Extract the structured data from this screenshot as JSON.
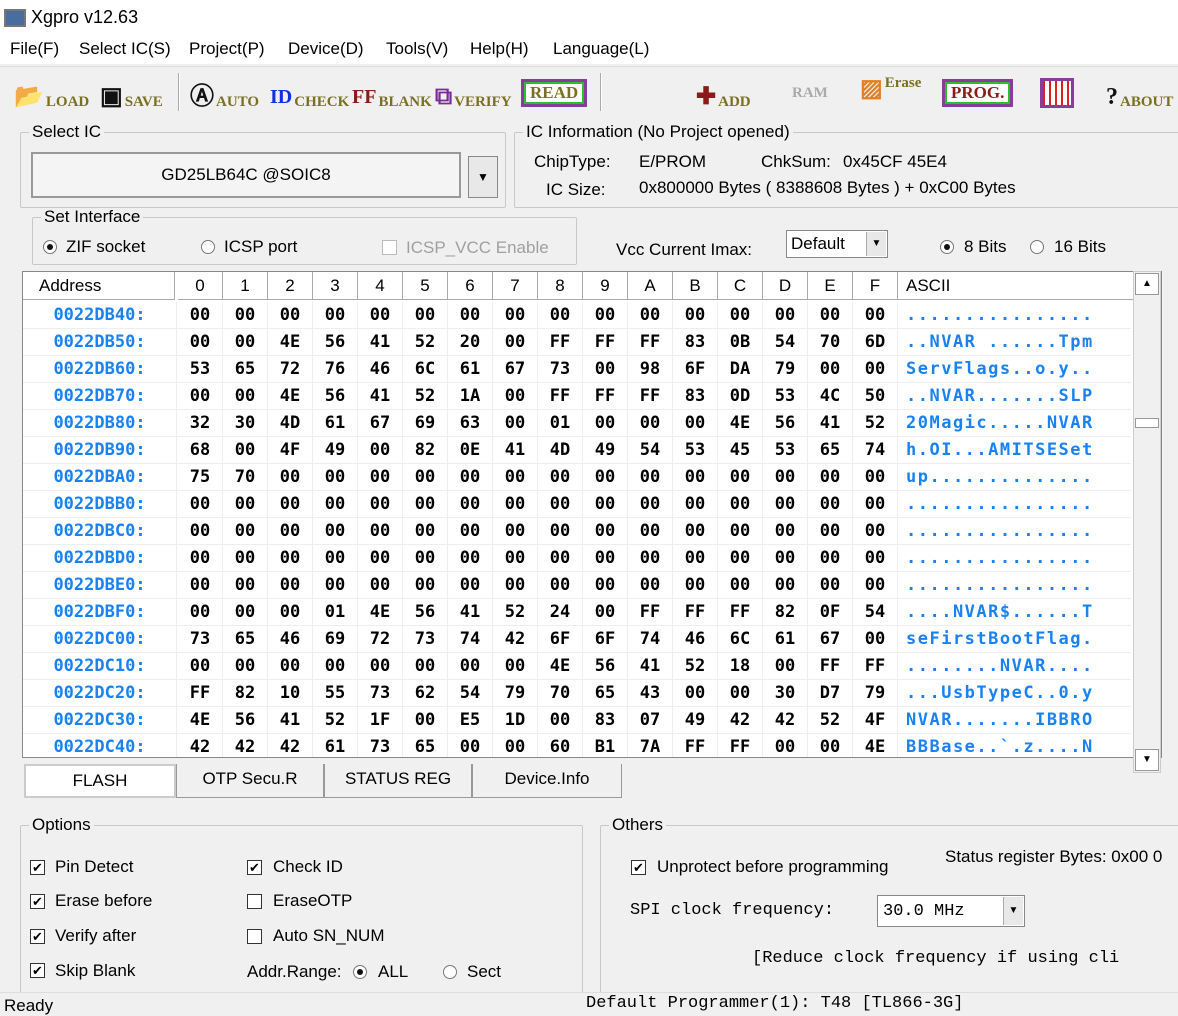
{
  "window": {
    "title": "Xgpro v12.63"
  },
  "menu": [
    "File(F)",
    "Select IC(S)",
    "Project(P)",
    "Device(D)",
    "Tools(V)",
    "Help(H)",
    "Language(L)"
  ],
  "toolbar": {
    "load": "LOAD",
    "save": "SAVE",
    "auto": "AUTO",
    "check": "CHECK",
    "blank": "BLANK",
    "verify": "VERIFY",
    "read": "READ",
    "add": "ADD",
    "ram": "RAM",
    "erase": "Erase",
    "prog": "PROG.",
    "about": "ABOUT",
    "check_icon_text": "ID",
    "blank_icon_text": "FF"
  },
  "select_ic": {
    "legend": "Select IC",
    "value": "GD25LB64C @SOIC8"
  },
  "ic_info": {
    "legend": "IC Information (No Project opened)",
    "chip_type_label": "ChipType:",
    "chip_type": "E/PROM",
    "chksum_label": "ChkSum:",
    "chksum": "0x45CF 45E4",
    "ic_size_label": "IC Size:",
    "ic_size": "0x800000 Bytes ( 8388608 Bytes ) + 0xC00 Bytes"
  },
  "interface": {
    "legend": "Set Interface",
    "zif": "ZIF socket",
    "icsp": "ICSP port",
    "icsp_vcc": "ICSP_VCC Enable",
    "selected": "ZIF socket"
  },
  "vcc": {
    "label": "Vcc Current Imax:",
    "value": "Default"
  },
  "bits": {
    "b8": "8 Bits",
    "b16": "16 Bits",
    "selected": "8 Bits"
  },
  "hex": {
    "headers": [
      "Address",
      "0",
      "1",
      "2",
      "3",
      "4",
      "5",
      "6",
      "7",
      "8",
      "9",
      "A",
      "B",
      "C",
      "D",
      "E",
      "F",
      "ASCII"
    ],
    "rows": [
      {
        "addr": "0022DB40:",
        "bytes": [
          "00",
          "00",
          "00",
          "00",
          "00",
          "00",
          "00",
          "00",
          "00",
          "00",
          "00",
          "00",
          "00",
          "00",
          "00",
          "00"
        ],
        "ascii": "................"
      },
      {
        "addr": "0022DB50:",
        "bytes": [
          "00",
          "00",
          "4E",
          "56",
          "41",
          "52",
          "20",
          "00",
          "FF",
          "FF",
          "FF",
          "83",
          "0B",
          "54",
          "70",
          "6D"
        ],
        "ascii": "..NVAR ......Tpm"
      },
      {
        "addr": "0022DB60:",
        "bytes": [
          "53",
          "65",
          "72",
          "76",
          "46",
          "6C",
          "61",
          "67",
          "73",
          "00",
          "98",
          "6F",
          "DA",
          "79",
          "00",
          "00"
        ],
        "ascii": "ServFlags..o.y.."
      },
      {
        "addr": "0022DB70:",
        "bytes": [
          "00",
          "00",
          "4E",
          "56",
          "41",
          "52",
          "1A",
          "00",
          "FF",
          "FF",
          "FF",
          "83",
          "0D",
          "53",
          "4C",
          "50"
        ],
        "ascii": "..NVAR.......SLP"
      },
      {
        "addr": "0022DB80:",
        "bytes": [
          "32",
          "30",
          "4D",
          "61",
          "67",
          "69",
          "63",
          "00",
          "01",
          "00",
          "00",
          "00",
          "4E",
          "56",
          "41",
          "52"
        ],
        "ascii": "20Magic.....NVAR"
      },
      {
        "addr": "0022DB90:",
        "bytes": [
          "68",
          "00",
          "4F",
          "49",
          "00",
          "82",
          "0E",
          "41",
          "4D",
          "49",
          "54",
          "53",
          "45",
          "53",
          "65",
          "74"
        ],
        "ascii": "h.OI...AMITSESet"
      },
      {
        "addr": "0022DBA0:",
        "bytes": [
          "75",
          "70",
          "00",
          "00",
          "00",
          "00",
          "00",
          "00",
          "00",
          "00",
          "00",
          "00",
          "00",
          "00",
          "00",
          "00"
        ],
        "ascii": "up.............."
      },
      {
        "addr": "0022DBB0:",
        "bytes": [
          "00",
          "00",
          "00",
          "00",
          "00",
          "00",
          "00",
          "00",
          "00",
          "00",
          "00",
          "00",
          "00",
          "00",
          "00",
          "00"
        ],
        "ascii": "................"
      },
      {
        "addr": "0022DBC0:",
        "bytes": [
          "00",
          "00",
          "00",
          "00",
          "00",
          "00",
          "00",
          "00",
          "00",
          "00",
          "00",
          "00",
          "00",
          "00",
          "00",
          "00"
        ],
        "ascii": "................"
      },
      {
        "addr": "0022DBD0:",
        "bytes": [
          "00",
          "00",
          "00",
          "00",
          "00",
          "00",
          "00",
          "00",
          "00",
          "00",
          "00",
          "00",
          "00",
          "00",
          "00",
          "00"
        ],
        "ascii": "................"
      },
      {
        "addr": "0022DBE0:",
        "bytes": [
          "00",
          "00",
          "00",
          "00",
          "00",
          "00",
          "00",
          "00",
          "00",
          "00",
          "00",
          "00",
          "00",
          "00",
          "00",
          "00"
        ],
        "ascii": "................"
      },
      {
        "addr": "0022DBF0:",
        "bytes": [
          "00",
          "00",
          "00",
          "01",
          "4E",
          "56",
          "41",
          "52",
          "24",
          "00",
          "FF",
          "FF",
          "FF",
          "82",
          "0F",
          "54"
        ],
        "ascii": "....NVAR$......T"
      },
      {
        "addr": "0022DC00:",
        "bytes": [
          "73",
          "65",
          "46",
          "69",
          "72",
          "73",
          "74",
          "42",
          "6F",
          "6F",
          "74",
          "46",
          "6C",
          "61",
          "67",
          "00"
        ],
        "ascii": "seFirstBootFlag."
      },
      {
        "addr": "0022DC10:",
        "bytes": [
          "00",
          "00",
          "00",
          "00",
          "00",
          "00",
          "00",
          "00",
          "4E",
          "56",
          "41",
          "52",
          "18",
          "00",
          "FF",
          "FF"
        ],
        "ascii": "........NVAR...."
      },
      {
        "addr": "0022DC20:",
        "bytes": [
          "FF",
          "82",
          "10",
          "55",
          "73",
          "62",
          "54",
          "79",
          "70",
          "65",
          "43",
          "00",
          "00",
          "30",
          "D7",
          "79"
        ],
        "ascii": "...UsbTypeC..0.y"
      },
      {
        "addr": "0022DC30:",
        "bytes": [
          "4E",
          "56",
          "41",
          "52",
          "1F",
          "00",
          "E5",
          "1D",
          "00",
          "83",
          "07",
          "49",
          "42",
          "42",
          "52",
          "4F"
        ],
        "ascii": "NVAR.......IBBRO"
      },
      {
        "addr": "0022DC40:",
        "bytes": [
          "42",
          "42",
          "42",
          "61",
          "73",
          "65",
          "00",
          "00",
          "60",
          "B1",
          "7A",
          "FF",
          "FF",
          "00",
          "00",
          "4E"
        ],
        "ascii": "BBBase..`.z....N"
      }
    ]
  },
  "tabs": [
    "FLASH",
    "OTP Secu.R",
    "STATUS REG",
    "Device.Info"
  ],
  "active_tab": "FLASH",
  "options": {
    "legend": "Options",
    "pin_detect": "Pin Detect",
    "erase_before": "Erase before",
    "verify_after": "Verify after",
    "skip_blank": "Skip Blank",
    "check_id": "Check ID",
    "erase_otp": "EraseOTP",
    "auto_sn": "Auto SN_NUM",
    "addr_range": "Addr.Range:",
    "all": "ALL",
    "sect": "Sect"
  },
  "others": {
    "legend": "Others",
    "unprotect": "Unprotect before programming",
    "status_reg": "Status register Bytes: 0x00 0",
    "spi_label": "SPI clock frequency:",
    "spi_value": "30.0 MHz",
    "note": "[Reduce clock frequency if using cli"
  },
  "status": {
    "left": "Ready",
    "programmer": "Default Programmer(1): T48 [TL866-3G]"
  },
  "colors": {
    "address": "#1a82f0",
    "ascii": "#1a82f0",
    "chip_border": "#8a3c9a",
    "add_icon": "#8b1a1a"
  }
}
